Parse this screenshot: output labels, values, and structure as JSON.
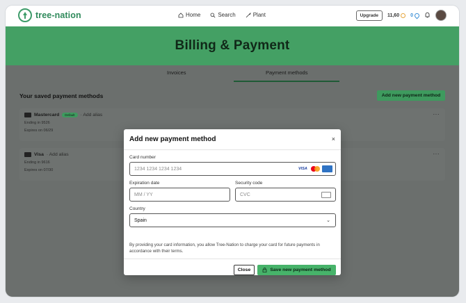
{
  "nav": {
    "logo_text": "tree-nation",
    "links": [
      {
        "label": "Home",
        "icon": "home-icon"
      },
      {
        "label": "Search",
        "icon": "search-icon"
      },
      {
        "label": "Plant",
        "icon": "plant-icon"
      }
    ],
    "upgrade_label": "Upgrade",
    "credits": "11,60",
    "water": "0"
  },
  "hero": {
    "title": "Billing & Payment"
  },
  "tabs": [
    {
      "label": "Invoices",
      "active": false
    },
    {
      "label": "Payment methods",
      "active": true
    }
  ],
  "saved": {
    "title": "Your saved payment methods",
    "add_button": "Add new payment method",
    "methods": [
      {
        "brand": "Mastercard",
        "badge": "Default",
        "alias": "· Add alias",
        "ending": "Ending in 9526",
        "expires": "Expires on 06/29"
      },
      {
        "brand": "Visa",
        "badge": "",
        "alias": "· Add alias",
        "ending": "Ending in 9616",
        "expires": "Expires on 07/30"
      }
    ],
    "more_label": "···"
  },
  "modal": {
    "title": "Add new payment method",
    "close_icon": "×",
    "card_number_label": "Card number",
    "card_number_placeholder": "1234 1234 1234 1234",
    "brand_visa": "VISA",
    "expiration_label": "Expiration date",
    "expiration_placeholder": "MM / YY",
    "security_label": "Security code",
    "security_placeholder": "CVC",
    "country_label": "Country",
    "country_value": "Spain",
    "notice": "By providing your card information, you allow Tree-Nation to charge your card for future payments in accordance with their terms.",
    "close_button": "Close",
    "save_button": "Save new payment method"
  },
  "colors": {
    "brand_green": "#44a064",
    "button_green": "#47b36a",
    "overlay": "#6b6f6d"
  }
}
